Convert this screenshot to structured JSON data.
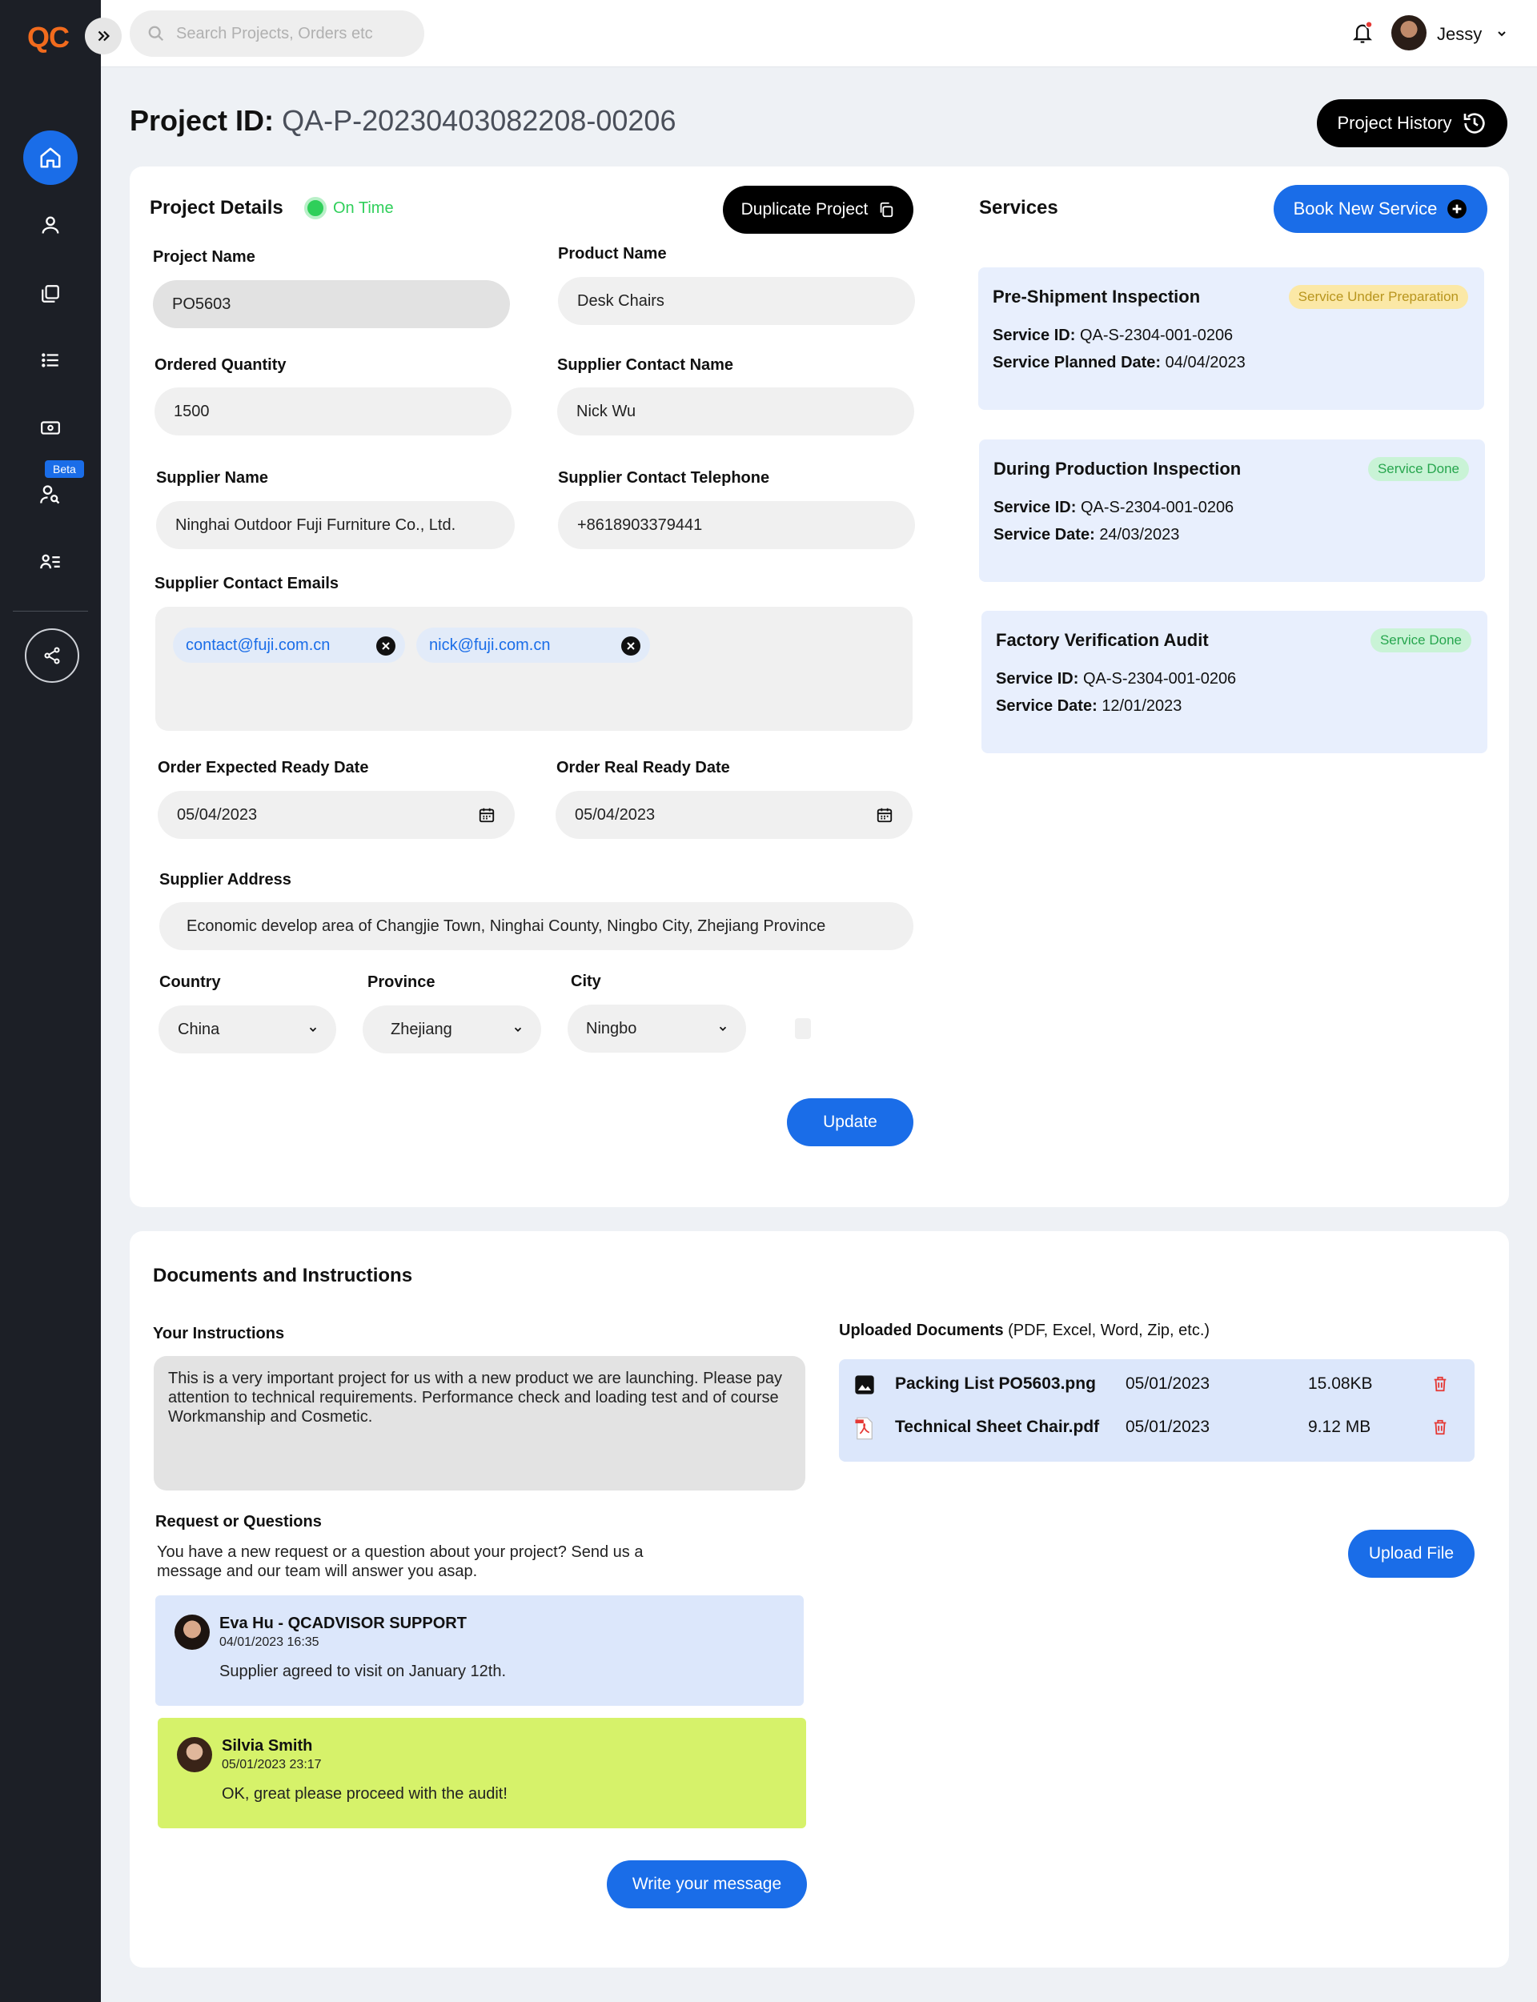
{
  "app": {
    "logo": "QC"
  },
  "search": {
    "placeholder": "Search Projects, Orders etc"
  },
  "user": {
    "name": "Jessy"
  },
  "sidebar": {
    "beta_label": "Beta"
  },
  "header": {
    "title_prefix": "Project ID:",
    "project_id": "QA-P-20230403082208-00206",
    "history_button": "Project History"
  },
  "details": {
    "title": "Project Details",
    "status": "On Time",
    "duplicate_button": "Duplicate Project",
    "project_name_label": "Project Name",
    "project_name": "PO5603",
    "product_name_label": "Product Name",
    "product_name": "Desk Chairs",
    "ordered_qty_label": "Ordered Quantity",
    "ordered_qty": "1500",
    "supplier_contact_name_label": "Supplier Contact Name",
    "supplier_contact_name": "Nick Wu",
    "supplier_name_label": "Supplier Name",
    "supplier_name": "Ninghai Outdoor Fuji Furniture Co., Ltd.",
    "supplier_tel_label": "Supplier Contact Telephone",
    "supplier_tel": "+8618903379441",
    "emails_label": "Supplier Contact Emails",
    "emails": [
      "contact@fuji.com.cn",
      "nick@fuji.com.cn"
    ],
    "expected_date_label": "Order Expected Ready Date",
    "expected_date": "05/04/2023",
    "real_date_label": "Order Real Ready Date",
    "real_date": "05/04/2023",
    "address_label": "Supplier Address",
    "address": "Economic develop area of Changjie Town, Ninghai County, Ningbo City, Zhejiang Province",
    "country_label": "Country",
    "country": "China",
    "province_label": "Province",
    "province": "Zhejiang",
    "city_label": "City",
    "city": "Ningbo",
    "update_button": "Update"
  },
  "services": {
    "title": "Services",
    "book_button": "Book New Service",
    "items": [
      {
        "title": "Pre-Shipment Inspection",
        "badge": "Service Under Preparation",
        "id_label": "Service ID:",
        "id": "QA-S-2304-001-0206",
        "date_label": "Service Planned Date:",
        "date": "04/04/2023"
      },
      {
        "title": "During Production Inspection",
        "badge": "Service Done",
        "id_label": "Service ID:",
        "id": "QA-S-2304-001-0206",
        "date_label": "Service  Date:",
        "date": "24/03/2023"
      },
      {
        "title": "Factory Verification Audit",
        "badge": "Service Done",
        "id_label": "Service ID:",
        "id": "QA-S-2304-001-0206",
        "date_label": "Service  Date:",
        "date": "12/01/2023"
      }
    ]
  },
  "documents": {
    "title": "Documents and Instructions",
    "instructions_label": "Your Instructions",
    "instructions": "This is a very important project for us with a new product we are launching. Please pay attention to technical requirements. Performance check and loading test and of course Workmanship and Cosmetic.",
    "uploaded_label": "Uploaded Documents",
    "uploaded_types": "(PDF, Excel, Word, Zip, etc.)",
    "files": [
      {
        "name": "Packing List PO5603.png",
        "date": "05/01/2023",
        "size": "15.08KB"
      },
      {
        "name": "Technical Sheet Chair.pdf",
        "date": "05/01/2023",
        "size": "9.12 MB"
      }
    ],
    "upload_button": "Upload File",
    "requests_label": "Request or Questions",
    "requests_text": "You have a new request or a question about your project? Send us a message and our team will answer you asap.",
    "messages": [
      {
        "name": "Eva Hu - QCADVISOR SUPPORT",
        "time": "04/01/2023 16:35",
        "text": "Supplier agreed to visit on January 12th."
      },
      {
        "name": "Silvia Smith",
        "time": "05/01/2023 23:17",
        "text": "OK, great please proceed with the audit!"
      }
    ],
    "write_button": "Write your message"
  }
}
